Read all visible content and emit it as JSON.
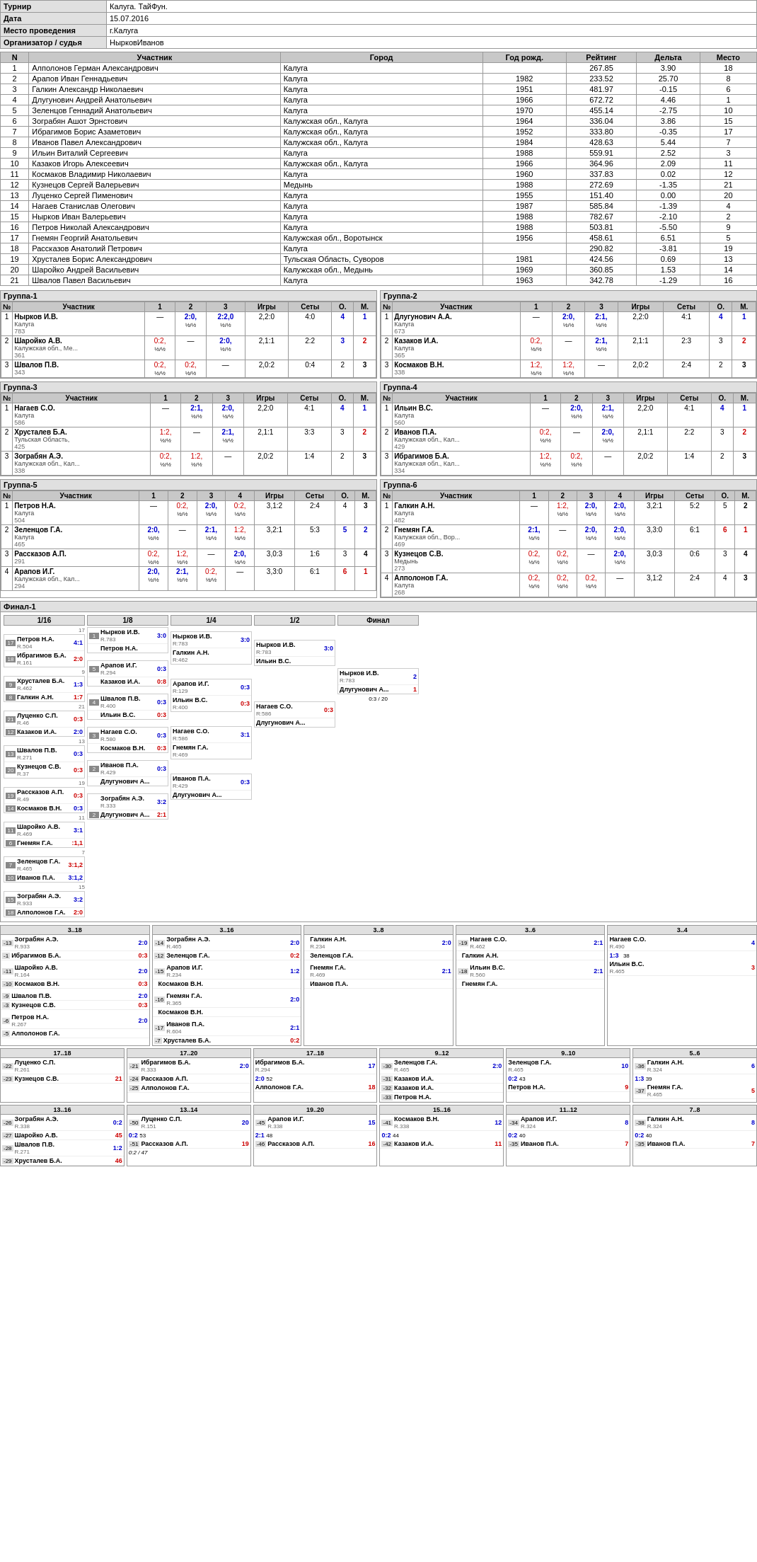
{
  "tournament": {
    "title_label": "Турнир",
    "title_value": "Калуга. ТайФун.",
    "date_label": "Дата",
    "date_value": "15.07.2016",
    "venue_label": "Место проведения",
    "venue_value": "г.Калуга",
    "organizer_label": "Организатор / судья",
    "organizer_value": "НырковИванов"
  },
  "participants_headers": [
    "N",
    "Участник",
    "Город",
    "Год рожд.",
    "Рейтинг",
    "Дельта",
    "Место"
  ],
  "participants": [
    [
      1,
      "Алполонов Герман Александрович",
      "Калуга",
      "",
      "267.85",
      "3.90",
      "18"
    ],
    [
      2,
      "Арапов Иван Геннадьевич",
      "Калуга",
      "1982",
      "233.52",
      "25.70",
      "8"
    ],
    [
      3,
      "Галкин Александр Николаевич",
      "Калуга",
      "1951",
      "481.97",
      "-0.15",
      "6"
    ],
    [
      4,
      "Длугунович Андрей Анатольевич",
      "Калуга",
      "1966",
      "672.72",
      "4.46",
      "1"
    ],
    [
      5,
      "Зеленцов Геннадий Анатольевич",
      "Калуга",
      "1970",
      "455.14",
      "-2.75",
      "10"
    ],
    [
      6,
      "Зограбян Ашот Эрнстович",
      "Калужская обл., Калуга",
      "1964",
      "336.04",
      "3.86",
      "15"
    ],
    [
      7,
      "Ибрагимов Борис Азаметович",
      "Калужская обл., Калуга",
      "1952",
      "333.80",
      "-0.35",
      "17"
    ],
    [
      8,
      "Иванов Павел Александрович",
      "Калужская обл., Калуга",
      "1984",
      "428.63",
      "5.44",
      "7"
    ],
    [
      9,
      "Ильин Виталий Сергеевич",
      "Калуга",
      "1988",
      "559.91",
      "2.52",
      "3"
    ],
    [
      10,
      "Казаков Игорь Алексеевич",
      "Калужская обл., Калуга",
      "1966",
      "364.96",
      "2.09",
      "11"
    ],
    [
      11,
      "Космаков Владимир Николаевич",
      "Калуга",
      "1960",
      "337.83",
      "0.02",
      "12"
    ],
    [
      12,
      "Кузнецов Сергей Валерьевич",
      "Медынь",
      "1988",
      "272.69",
      "-1.35",
      "21"
    ],
    [
      13,
      "Луценко Сергей Пименович",
      "Калуга",
      "1955",
      "151.40",
      "0.00",
      "20"
    ],
    [
      14,
      "Нагаев Станислав Олегович",
      "Калуга",
      "1987",
      "585.84",
      "-1.39",
      "4"
    ],
    [
      15,
      "Нырков Иван Валерьевич",
      "Калуга",
      "1988",
      "782.67",
      "-2.10",
      "2"
    ],
    [
      16,
      "Петров Николай Александрович",
      "Калуга",
      "1988",
      "503.81",
      "-5.50",
      "9"
    ],
    [
      17,
      "Гнемян Георгий Анатольевич",
      "Калужская обл., Воротынск",
      "1956",
      "458.61",
      "6.51",
      "5"
    ],
    [
      18,
      "Рассказов Анатолий Петрович",
      "Калуга",
      "",
      "290.82",
      "-3.81",
      "19"
    ],
    [
      19,
      "Хрусталев Борис Александрович",
      "Тульская Область, Суворов",
      "1981",
      "424.56",
      "0.69",
      "13"
    ],
    [
      20,
      "Шаройко Андрей Васильевич",
      "Калужская обл., Медынь",
      "1969",
      "360.85",
      "1.53",
      "14"
    ],
    [
      21,
      "Швалов Павел Васильевич",
      "Калуга",
      "1963",
      "342.78",
      "-1.29",
      "16"
    ]
  ],
  "groups": {
    "group1": {
      "title": "Группа-1",
      "players": [
        {
          "n": 1,
          "name": "Нырков И.В.",
          "city": "Калуга",
          "rating": "783"
        },
        {
          "n": 2,
          "name": "Шаройко А.В.",
          "city": "Калужская обл., Ме...",
          "rating": "361"
        },
        {
          "n": 3,
          "name": "Швалов П.В.",
          "city": "",
          "rating": "343"
        }
      ]
    },
    "group2": {
      "title": "Группа-2",
      "players": [
        {
          "n": 1,
          "name": "Длугунович А.А.",
          "city": "Калуга",
          "rating": "673"
        },
        {
          "n": 2,
          "name": "Казаков И.А.",
          "city": "Калуга",
          "rating": "365"
        },
        {
          "n": 3,
          "name": "Космаков В.Н.",
          "city": "",
          "rating": "338"
        }
      ]
    },
    "group3": {
      "title": "Группа-3",
      "players": [
        {
          "n": 1,
          "name": "Нагаев С.О.",
          "city": "Калуга",
          "rating": "586"
        },
        {
          "n": 2,
          "name": "Хрусталев Б.А.",
          "city": "Тульская Область,",
          "rating": "425"
        },
        {
          "n": 3,
          "name": "Зограбян А.Э.",
          "city": "Калужская обл., Кал...",
          "rating": "338"
        }
      ]
    },
    "group4": {
      "title": "Группа-4",
      "players": [
        {
          "n": 1,
          "name": "Ильин В.С.",
          "city": "Калуга",
          "rating": "560"
        },
        {
          "n": 2,
          "name": "Иванов П.А.",
          "city": "Калужская обл., Кал...",
          "rating": "429"
        },
        {
          "n": 3,
          "name": "Ибрагимов Б.А.",
          "city": "Калужская обл., Кал...",
          "rating": "334"
        }
      ]
    },
    "group5": {
      "title": "Группа-5",
      "players": [
        {
          "n": 1,
          "name": "Петров Н.А.",
          "city": "Калуга",
          "rating": "504"
        },
        {
          "n": 2,
          "name": "Зеленцов Г.А.",
          "city": "Калуга",
          "rating": "465"
        },
        {
          "n": 3,
          "name": "Рассказов А.П.",
          "city": "",
          "rating": "291"
        },
        {
          "n": 4,
          "name": "Арапов И.Г.",
          "city": "Калужская обл., Кал...",
          "rating": "294"
        }
      ]
    },
    "group6": {
      "title": "Группа-6",
      "players": [
        {
          "n": 1,
          "name": "Галкин А.Н.",
          "city": "Калуга",
          "rating": "482"
        },
        {
          "n": 2,
          "name": "Гнемян Г.А.",
          "city": "Калужская обл., Вор...",
          "rating": "469"
        },
        {
          "n": 3,
          "name": "Кузнецов С.В.",
          "city": "Медынь",
          "rating": "273"
        },
        {
          "n": 4,
          "name": "Алполонов Г.А.",
          "city": "Калуга",
          "rating": "268"
        }
      ]
    }
  },
  "finals_title": "Финал-1",
  "bracket_rounds": [
    "1/16",
    "1/8",
    "1/4",
    "1/2",
    "Финал"
  ],
  "placement_sections": {
    "row1_title": "3..18",
    "row2_title": "17..18",
    "row3_title": "13..16"
  }
}
